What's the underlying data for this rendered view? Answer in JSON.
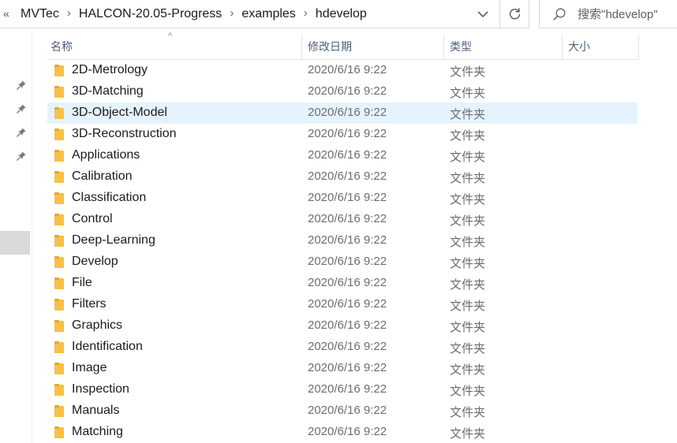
{
  "address_bar": {
    "overflow": "«",
    "crumbs": [
      "MVTec",
      "HALCON-20.05-Progress",
      "examples",
      "hdevelop"
    ]
  },
  "search": {
    "placeholder": "搜索\"hdevelop\""
  },
  "columns": {
    "name": "名称",
    "date": "修改日期",
    "type": "类型",
    "size": "大小"
  },
  "files": [
    {
      "name": "2D-Metrology",
      "date": "2020/6/16 9:22",
      "type": "文件夹"
    },
    {
      "name": "3D-Matching",
      "date": "2020/6/16 9:22",
      "type": "文件夹"
    },
    {
      "name": "3D-Object-Model",
      "date": "2020/6/16 9:22",
      "type": "文件夹",
      "selected": true
    },
    {
      "name": "3D-Reconstruction",
      "date": "2020/6/16 9:22",
      "type": "文件夹"
    },
    {
      "name": "Applications",
      "date": "2020/6/16 9:22",
      "type": "文件夹"
    },
    {
      "name": "Calibration",
      "date": "2020/6/16 9:22",
      "type": "文件夹"
    },
    {
      "name": "Classification",
      "date": "2020/6/16 9:22",
      "type": "文件夹"
    },
    {
      "name": "Control",
      "date": "2020/6/16 9:22",
      "type": "文件夹"
    },
    {
      "name": "Deep-Learning",
      "date": "2020/6/16 9:22",
      "type": "文件夹"
    },
    {
      "name": "Develop",
      "date": "2020/6/16 9:22",
      "type": "文件夹"
    },
    {
      "name": "File",
      "date": "2020/6/16 9:22",
      "type": "文件夹"
    },
    {
      "name": "Filters",
      "date": "2020/6/16 9:22",
      "type": "文件夹"
    },
    {
      "name": "Graphics",
      "date": "2020/6/16 9:22",
      "type": "文件夹"
    },
    {
      "name": "Identification",
      "date": "2020/6/16 9:22",
      "type": "文件夹"
    },
    {
      "name": "Image",
      "date": "2020/6/16 9:22",
      "type": "文件夹"
    },
    {
      "name": "Inspection",
      "date": "2020/6/16 9:22",
      "type": "文件夹"
    },
    {
      "name": "Manuals",
      "date": "2020/6/16 9:22",
      "type": "文件夹"
    },
    {
      "name": "Matching",
      "date": "2020/6/16 9:22",
      "type": "文件夹"
    }
  ],
  "colors": {
    "folder": "#f8c146",
    "selected_row": "#e5f3ff",
    "header_text": "#4c607a"
  },
  "icons": {
    "pin": "pin-icon",
    "folder": "folder-icon",
    "search": "search-icon",
    "refresh": "refresh-icon",
    "dropdown": "chevron-down-icon"
  }
}
